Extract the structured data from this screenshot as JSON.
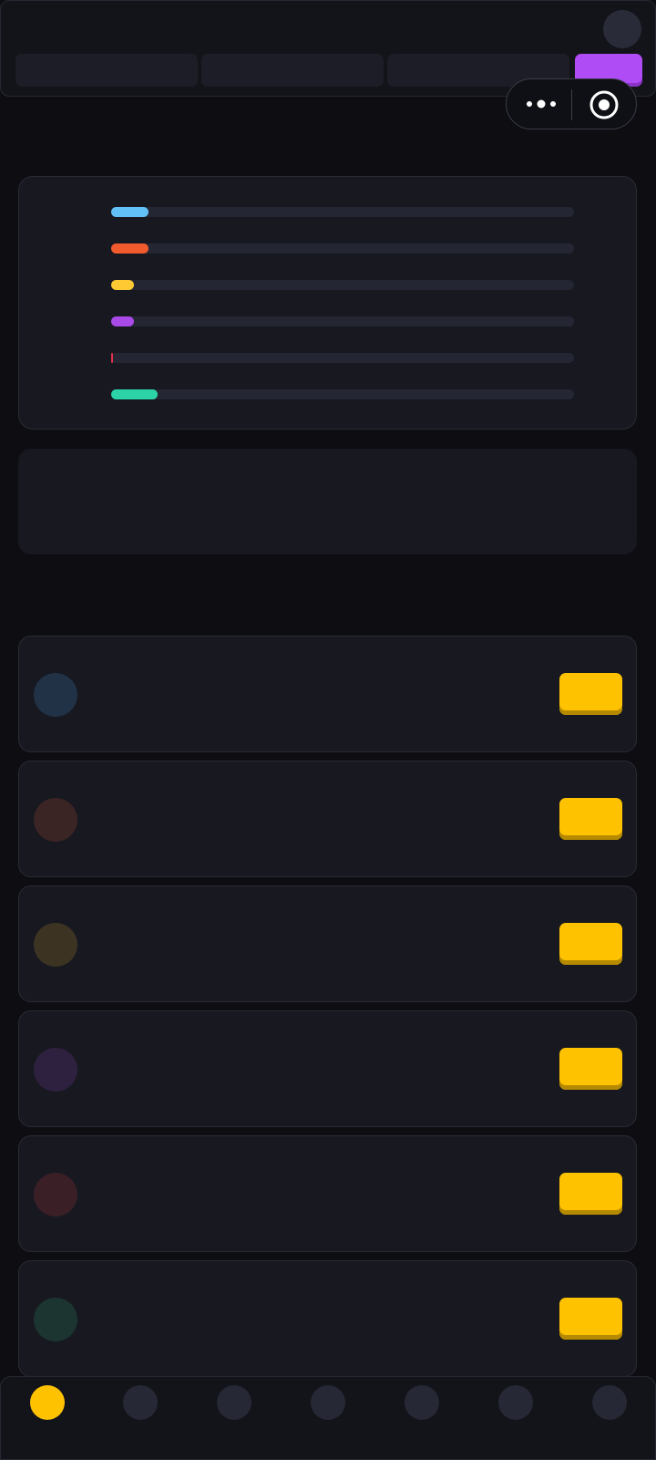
{
  "colors": {
    "background": "#0d0d12",
    "card": "#171820",
    "accent_purple": "#b04cf5",
    "accent_yellow": "#ffc200"
  },
  "header": {
    "tabs": [
      {
        "label": "",
        "active": false
      },
      {
        "label": "",
        "active": false
      },
      {
        "label": "",
        "active": false
      },
      {
        "label": "",
        "active": true
      }
    ],
    "avatar_icon": "avatar-placeholder"
  },
  "capsule": {
    "more_icon": "more-dots-icon",
    "close_icon": "target-circle-icon"
  },
  "bars": [
    {
      "color": "#62c1f6",
      "fraction": 0.08
    },
    {
      "color": "#f05a2d",
      "fraction": 0.08
    },
    {
      "color": "#ffc933",
      "fraction": 0.05
    },
    {
      "color": "#a94ae8",
      "fraction": 0.05
    },
    {
      "color": "#e2314a",
      "fraction": 0.003
    },
    {
      "color": "#2cd3a7",
      "fraction": 0.1
    }
  ],
  "list": [
    {
      "icon_color": "#213246"
    },
    {
      "icon_color": "#3b2424"
    },
    {
      "icon_color": "#3c3322"
    },
    {
      "icon_color": "#2e2140"
    },
    {
      "icon_color": "#3a1f27"
    },
    {
      "icon_color": "#1c3530"
    }
  ],
  "bottom_nav": [
    {
      "active": true
    },
    {
      "active": false
    },
    {
      "active": false
    },
    {
      "active": false
    },
    {
      "active": false
    },
    {
      "active": false
    },
    {
      "active": false
    }
  ]
}
